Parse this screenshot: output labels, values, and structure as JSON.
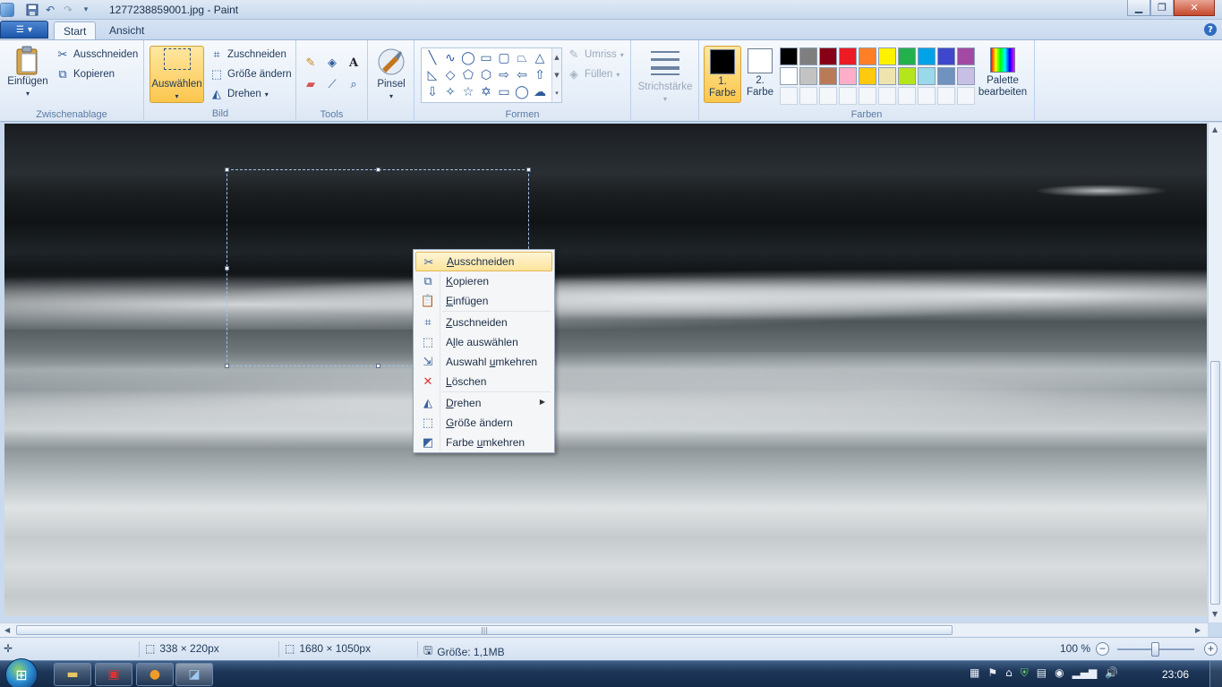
{
  "window": {
    "title": "1277238859001.jpg - Paint"
  },
  "tabs": [
    "Start",
    "Ansicht"
  ],
  "clipboard": {
    "paste": "Einfügen",
    "cut": "Ausschneiden",
    "copy": "Kopieren",
    "group": "Zwischenablage"
  },
  "image": {
    "select": "Auswählen",
    "crop": "Zuschneiden",
    "resize": "Größe ändern",
    "rotate": "Drehen",
    "group": "Bild"
  },
  "tools": {
    "group": "Tools",
    "brush": "Pinsel"
  },
  "shapes": {
    "group": "Formen",
    "outline": "Umriss",
    "fill": "Füllen"
  },
  "stroke": {
    "label": "Strichstärke"
  },
  "colors": {
    "color1_line1": "1.",
    "color1_line2": "Farbe",
    "color2_line1": "2.",
    "color2_line2": "Farbe",
    "edit_line1": "Palette",
    "edit_line2": "bearbeiten",
    "group": "Farben",
    "color1": "#000000",
    "color2": "#ffffff",
    "palette_row1": [
      "#000000",
      "#7f7f7f",
      "#880015",
      "#ed1c24",
      "#ff7f27",
      "#fff200",
      "#22b14c",
      "#00a2e8",
      "#3f48cc",
      "#a349a4"
    ],
    "palette_row2": [
      "#ffffff",
      "#c3c3c3",
      "#b97a57",
      "#ffaec9",
      "#ffc90e",
      "#efe4b0",
      "#b5e61d",
      "#99d9ea",
      "#7092be",
      "#c8bfe7"
    ]
  },
  "context_menu": {
    "items": [
      {
        "pre": "",
        "key": "A",
        "post": "usschneiden",
        "icon": "scissors-icon"
      },
      {
        "pre": "",
        "key": "K",
        "post": "opieren",
        "icon": "copy-icon"
      },
      {
        "pre": "",
        "key": "E",
        "post": "infügen",
        "icon": "paste-icon"
      },
      {
        "pre": "",
        "key": "Z",
        "post": "uschneiden",
        "icon": "crop-icon"
      },
      {
        "pre": "A",
        "key": "l",
        "post": "le auswählen",
        "icon": "select-all-icon"
      },
      {
        "pre": "Auswahl ",
        "key": "u",
        "post": "mkehren",
        "icon": "invert-selection-icon"
      },
      {
        "pre": "",
        "key": "L",
        "post": "öschen",
        "icon": "delete-icon"
      },
      {
        "pre": "",
        "key": "D",
        "post": "rehen",
        "icon": "rotate-icon"
      },
      {
        "pre": "",
        "key": "G",
        "post": "röße ändern",
        "icon": "resize-icon"
      },
      {
        "pre": "Farbe ",
        "key": "u",
        "post": "mkehren",
        "icon": "invert-color-icon"
      }
    ]
  },
  "status": {
    "selection_size": "338 × 220px",
    "image_size": "1680 × 1050px",
    "file_size": "Größe: 1,1MB",
    "zoom": "100 %"
  },
  "taskbar": {
    "clock": "23:06"
  }
}
